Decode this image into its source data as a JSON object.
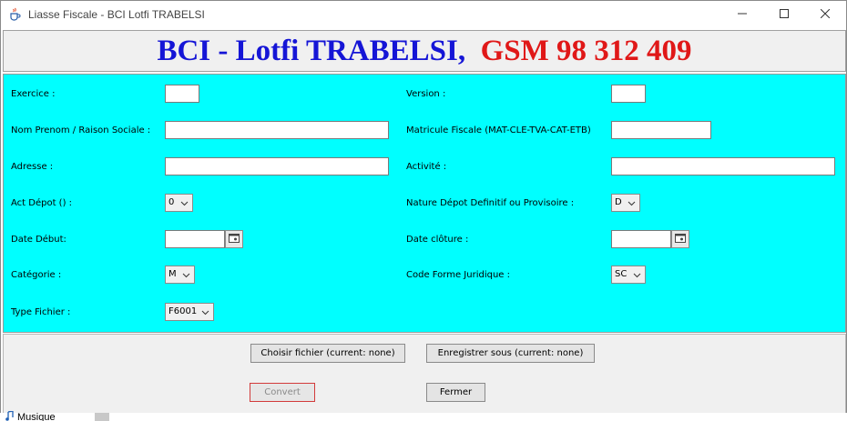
{
  "window": {
    "title": "Liasse Fiscale - BCI Lotfi TRABELSI",
    "app_icon": "java-cup-icon"
  },
  "banner": {
    "name": "BCI - Lotfi TRABELSI,",
    "phone": "GSM  98 312 409",
    "colors": {
      "name": "#1515d6",
      "phone": "#e01818"
    }
  },
  "form": {
    "background": "#00ffff",
    "exercice": {
      "label": "Exercice :",
      "value": ""
    },
    "version": {
      "label": "Version :",
      "value": ""
    },
    "nom_prenom": {
      "label": "Nom Prenom / Raison Sociale :",
      "value": ""
    },
    "matricule": {
      "label": "Matricule Fiscale (MAT-CLE-TVA-CAT-ETB)",
      "value": ""
    },
    "adresse": {
      "label": "Adresse :",
      "value": ""
    },
    "activite": {
      "label": "Activité :",
      "value": ""
    },
    "act_depot": {
      "label": "Act Dépot () :",
      "selected": "0"
    },
    "nature_depot": {
      "label": "Nature Dépot Definitif ou Provisoire :",
      "selected": "D"
    },
    "date_debut": {
      "label": "Date Début:",
      "value": ""
    },
    "date_cloture": {
      "label": "Date clôture :",
      "value": ""
    },
    "categorie": {
      "label": "Catégorie :",
      "selected": "M"
    },
    "code_forme": {
      "label": "Code Forme Juridique :",
      "selected": "SC"
    },
    "type_fichier": {
      "label": "Type Fichier :",
      "selected": "F6001"
    }
  },
  "actions": {
    "choose_file": "Choisir fichier (current: none)",
    "save_as": "Enregistrer sous (current: none)",
    "convert": "Convert",
    "close": "Fermer"
  },
  "background": {
    "music_label": "Musique"
  }
}
